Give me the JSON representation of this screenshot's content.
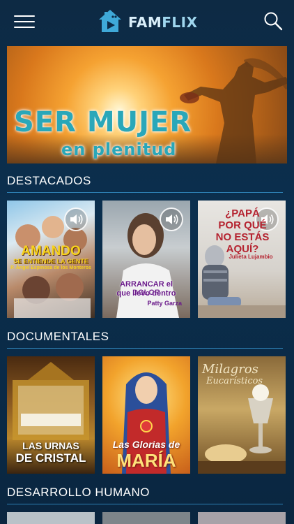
{
  "app": {
    "name_part1": "FAM",
    "name_part2": "FLIX"
  },
  "icons": {
    "menu": "hamburger-menu-icon",
    "search": "magnifier-search-icon",
    "logo": "house-play-logo-icon",
    "audio": "speaker-icon"
  },
  "hero": {
    "title": "SER MUJER",
    "subtitle": "en plenitud"
  },
  "sections": [
    {
      "title": "DESTACADOS",
      "cards": [
        {
          "title": "AMANDO",
          "subtitle": "SE ENTIENDE LA GENTE",
          "credit": "P. Ángel Espinosa de los Monteros",
          "has_audio": true
        },
        {
          "title": "ARRANCAR el DOLOR",
          "subtitle": "que llevo dentro",
          "credit": "Patty Garza",
          "has_audio": true
        },
        {
          "title": "¿PAPÁ POR QUÉ NO ESTÁS AQUÍ?",
          "credit": "Julieta Lujambio",
          "has_audio": true
        }
      ]
    },
    {
      "title": "DOCUMENTALES",
      "cards": [
        {
          "title": "LAS URNAS",
          "subtitle": "DE CRISTAL"
        },
        {
          "title": "Las Glorias de",
          "subtitle": "MARÍA"
        },
        {
          "title": "Milagros",
          "subtitle": "Eucarísticos"
        }
      ]
    },
    {
      "title": "DESARROLLO HUMANO",
      "cards": []
    }
  ],
  "colors": {
    "background": "#0c2b47",
    "accent_line": "#2d7fb3",
    "logo_text": "#d9eef9",
    "hero_title": "#2aa7b9"
  }
}
